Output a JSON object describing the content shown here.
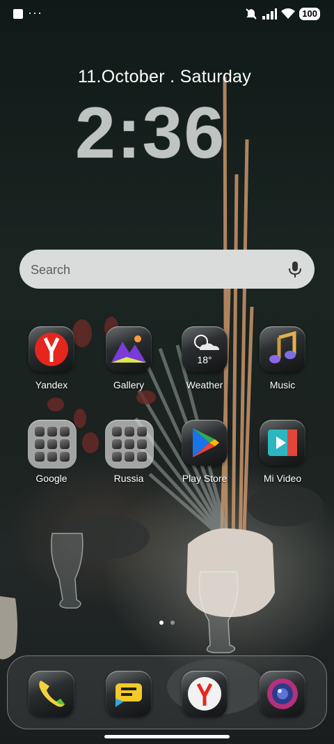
{
  "status_bar": {
    "battery": "100",
    "icons": [
      "notification-square-icon",
      "more-dots-icon",
      "mute-icon",
      "signal-icon",
      "wifi-icon",
      "battery-icon"
    ]
  },
  "clock": {
    "date": "11.October . Saturday",
    "time": "2:36"
  },
  "search": {
    "placeholder": "Search"
  },
  "apps": [
    {
      "label": "Yandex"
    },
    {
      "label": "Gallery"
    },
    {
      "label": "Weather",
      "temp": "18°"
    },
    {
      "label": "Music"
    },
    {
      "label": "Google"
    },
    {
      "label": "Russia"
    },
    {
      "label": "Play Store"
    },
    {
      "label": "Mi Video"
    }
  ],
  "dock": {
    "apps": [
      "phone-icon",
      "messages-icon",
      "yandex-browser-icon",
      "camera-icon"
    ]
  },
  "pager": {
    "pages": 2,
    "current": 1
  },
  "colors": {
    "yandex_red": "#e5261d",
    "play_green": "#1db954",
    "search_bg": "#d9dcdb"
  }
}
